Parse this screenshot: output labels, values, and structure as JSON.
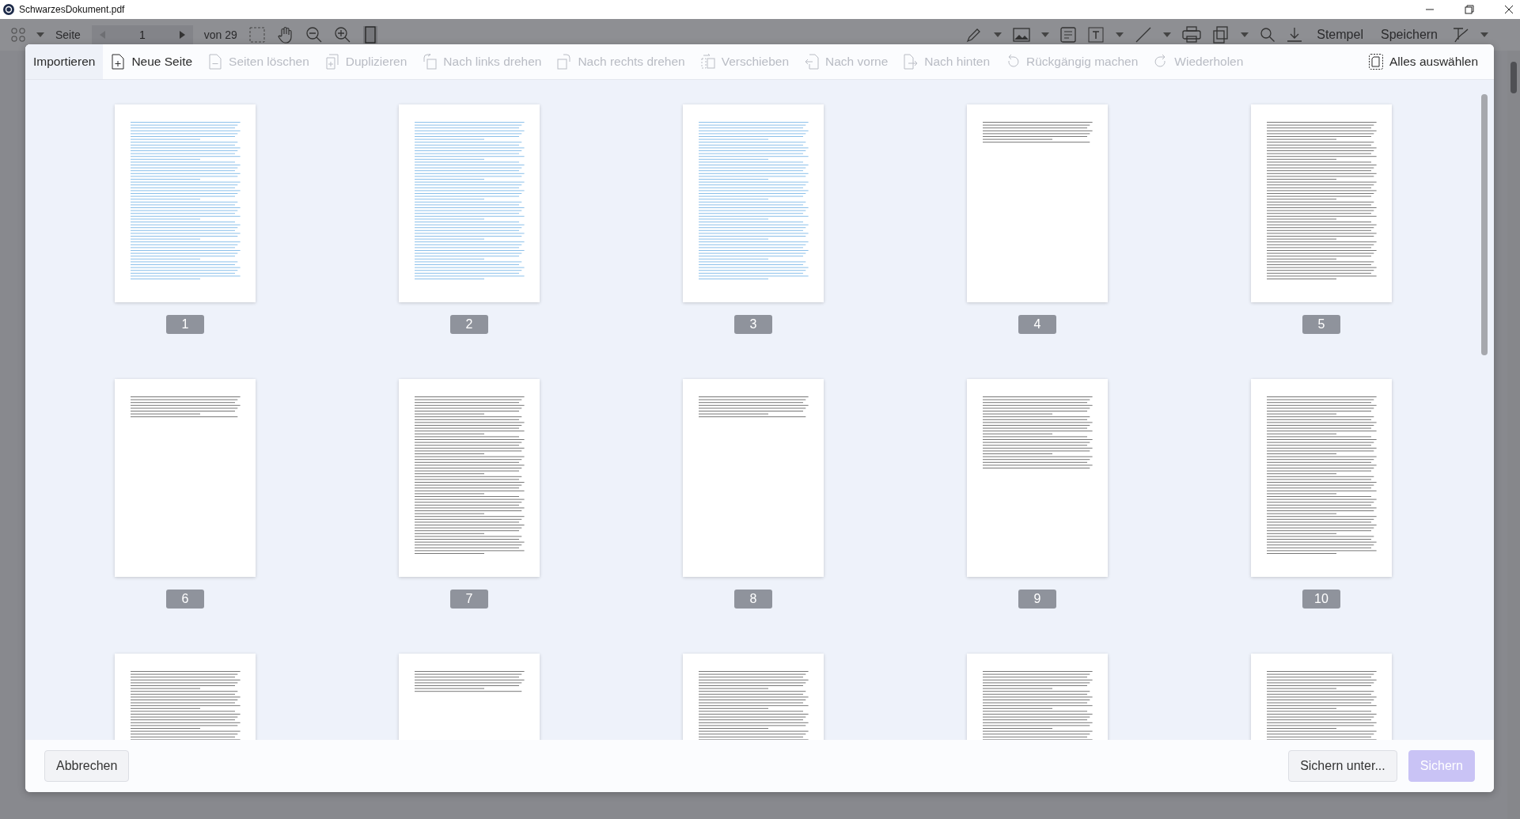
{
  "window": {
    "title": "SchwarzesDokument.pdf"
  },
  "viewer_toolbar": {
    "page_label": "Seite",
    "page_value": "1",
    "page_total": "von 29",
    "stamp": "Stempel",
    "save": "Speichern"
  },
  "tools": [
    {
      "label": "Importieren",
      "kind": "none",
      "disabled": false,
      "selected": true
    },
    {
      "label": "Neue Seite",
      "kind": "page-plus",
      "disabled": false,
      "selected": false
    },
    {
      "label": "Seiten löschen",
      "kind": "page-minus",
      "disabled": true,
      "selected": false
    },
    {
      "label": "Duplizieren",
      "kind": "duplicate",
      "disabled": true,
      "selected": false
    },
    {
      "label": "Nach links drehen",
      "kind": "rotate-left",
      "disabled": true,
      "selected": false
    },
    {
      "label": "Nach rechts drehen",
      "kind": "rotate-right",
      "disabled": true,
      "selected": false
    },
    {
      "label": "Verschieben",
      "kind": "move",
      "disabled": true,
      "selected": false
    },
    {
      "label": "Nach vorne",
      "kind": "forward",
      "disabled": true,
      "selected": false
    },
    {
      "label": "Nach hinten",
      "kind": "backward",
      "disabled": true,
      "selected": false
    },
    {
      "label": "Rückgängig machen",
      "kind": "undo",
      "disabled": true,
      "selected": false
    },
    {
      "label": "Wiederholen",
      "kind": "redo",
      "disabled": true,
      "selected": false
    },
    {
      "label": "Alles auswählen",
      "kind": "select-all",
      "disabled": false,
      "selected": false
    }
  ],
  "pages": [
    {
      "label": "1",
      "kind": "highlighted"
    },
    {
      "label": "2",
      "kind": "highlighted"
    },
    {
      "label": "3",
      "kind": "highlighted"
    },
    {
      "label": "4",
      "kind": "short"
    },
    {
      "label": "5",
      "kind": "full"
    },
    {
      "label": "6",
      "kind": "short"
    },
    {
      "label": "7",
      "kind": "full"
    },
    {
      "label": "8",
      "kind": "short"
    },
    {
      "label": "9",
      "kind": "half"
    },
    {
      "label": "10",
      "kind": "full"
    },
    {
      "kind": "full"
    },
    {
      "kind": "short"
    },
    {
      "kind": "full"
    },
    {
      "kind": "full"
    },
    {
      "kind": "full"
    }
  ],
  "footer": {
    "cancel": "Abbrechen",
    "save_as": "Sichern unter...",
    "save": {
      "label": "Sichern",
      "disabled": true
    }
  }
}
